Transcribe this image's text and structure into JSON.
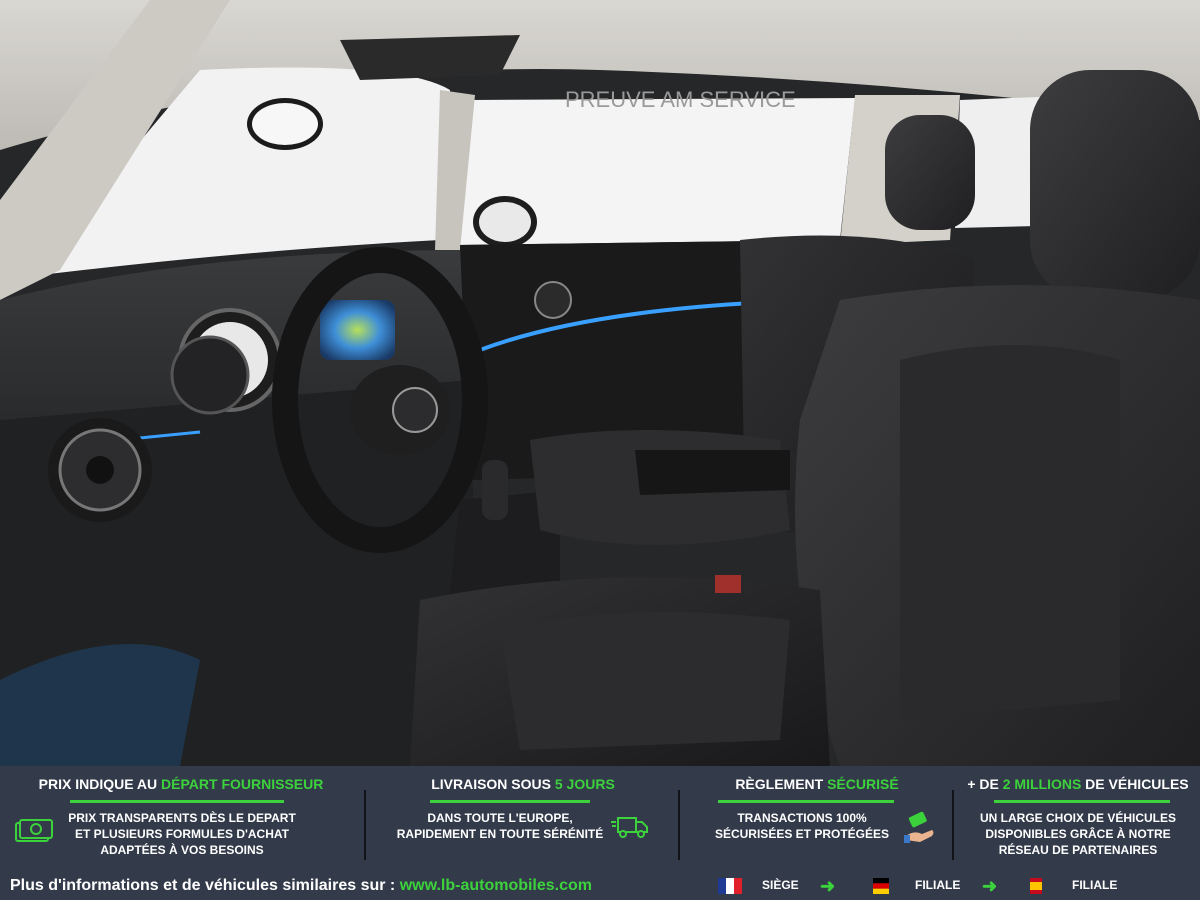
{
  "image": {
    "description_icon": "car-interior-photo",
    "watermark": "PREUVE AM SERVICE"
  },
  "banner": {
    "features": [
      {
        "title_pre": "PRIX INDIQUE AU ",
        "title_hl": "DÉPART FOURNISSEUR",
        "title_post": "",
        "lines": [
          "PRIX TRANSPARENTS DÈS LE DEPART",
          "ET PLUSIEURS FORMULES D'ACHAT",
          "ADAPTÉES À VOS BESOINS"
        ],
        "icon": "money-icon"
      },
      {
        "title_pre": "LIVRAISON SOUS ",
        "title_hl": "5 JOURS",
        "title_post": "",
        "lines": [
          "DANS TOUTE L'EUROPE,",
          "RAPIDEMENT EN TOUTE SÉRÉNITÉ"
        ],
        "icon": "delivery-truck-icon"
      },
      {
        "title_pre": "RÈGLEMENT ",
        "title_hl": "SÉCURISÉ",
        "title_post": "",
        "lines": [
          "TRANSACTIONS 100%",
          "SÉCURISÉES ET PROTÉGÉES"
        ],
        "icon": "payment-hand-icon"
      },
      {
        "title_pre": "+ DE ",
        "title_hl": "2 MILLIONS",
        "title_post": " DE VÉHICULES",
        "lines": [
          "UN LARGE CHOIX DE VÉHICULES",
          "DISPONIBLES GRÂCE À NOTRE",
          "RÉSEAU DE PARTENAIRES"
        ],
        "icon": ""
      }
    ],
    "footer": {
      "text": "Plus d'informations et de véhicules similaires sur : ",
      "link": "www.lb-automobiles.com",
      "entities": [
        {
          "flag": "france-flag-icon",
          "label": "SIÈGE"
        },
        {
          "flag": "germany-flag-icon",
          "label": "FILIALE"
        },
        {
          "flag": "spain-flag-icon",
          "label": "FILIALE"
        }
      ]
    }
  },
  "colors": {
    "accent_green": "#3cd23c",
    "banner_bg": "#333a4a",
    "ambient_blue": "#3aa0ff"
  }
}
